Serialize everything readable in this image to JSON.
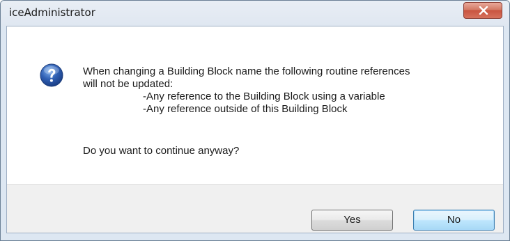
{
  "window": {
    "title": "iceAdministrator",
    "close_icon": "close-icon"
  },
  "dialog": {
    "icon": "question-icon",
    "message_lines": [
      "When changing a Building Block name the following routine references",
      "will not be updated:",
      "-Any reference to the Building Block using a variable",
      "-Any reference outside of this Building Block"
    ],
    "question": "Do you want to continue anyway?"
  },
  "buttons": {
    "yes_label": "Yes",
    "no_label": "No"
  },
  "colors": {
    "close_button": "#c9543f",
    "question_icon": "#2f5fb3",
    "default_button_border": "#3c7fb1"
  }
}
